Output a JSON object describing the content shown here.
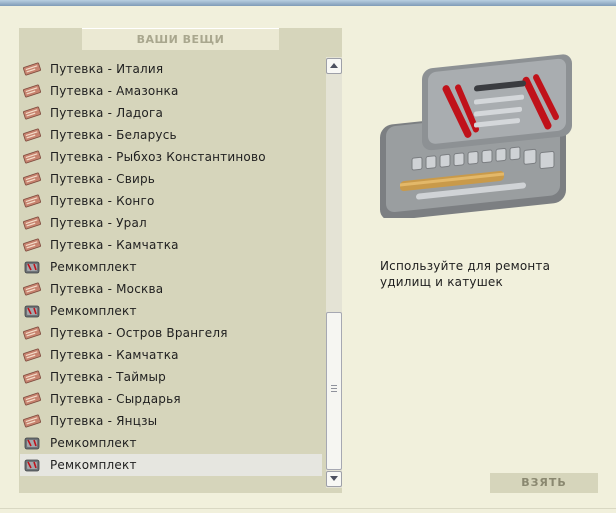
{
  "panel": {
    "title": "ВАШИ ВЕЩИ"
  },
  "items": [
    {
      "label": "Путевка - Италия",
      "icon": "voucher-icon"
    },
    {
      "label": "Путевка - Амазонка",
      "icon": "voucher-icon"
    },
    {
      "label": "Путевка - Ладога",
      "icon": "voucher-icon"
    },
    {
      "label": "Путевка - Беларусь",
      "icon": "voucher-icon"
    },
    {
      "label": "Путевка - Рыбхоз Константиново",
      "icon": "voucher-icon"
    },
    {
      "label": "Путевка - Свирь",
      "icon": "voucher-icon"
    },
    {
      "label": "Путевка - Конго",
      "icon": "voucher-icon"
    },
    {
      "label": "Путевка - Урал",
      "icon": "voucher-icon"
    },
    {
      "label": "Путевка - Камчатка",
      "icon": "voucher-icon"
    },
    {
      "label": "Ремкомплект",
      "icon": "repair-kit-icon"
    },
    {
      "label": "Путевка - Москва",
      "icon": "voucher-icon"
    },
    {
      "label": "Ремкомплект",
      "icon": "repair-kit-icon"
    },
    {
      "label": "Путевка - Остров Врангеля",
      "icon": "voucher-icon"
    },
    {
      "label": "Путевка - Камчатка",
      "icon": "voucher-icon"
    },
    {
      "label": "Путевка - Таймыр",
      "icon": "voucher-icon"
    },
    {
      "label": "Путевка - Сырдарья",
      "icon": "voucher-icon"
    },
    {
      "label": "Путевка - Янцзы",
      "icon": "voucher-icon"
    },
    {
      "label": "Ремкомплект",
      "icon": "repair-kit-icon"
    },
    {
      "label": "Ремкомплект",
      "icon": "repair-kit-icon",
      "selected": true
    }
  ],
  "detail": {
    "image": "toolbox-icon",
    "description": "Используйте для ремонта удилищ и катушек"
  },
  "actions": {
    "take_label": "ВЗЯТЬ"
  },
  "colors": {
    "panel": "#d6d5bb",
    "background": "#f1f0dc",
    "selected_row": "#e6e6e0"
  }
}
